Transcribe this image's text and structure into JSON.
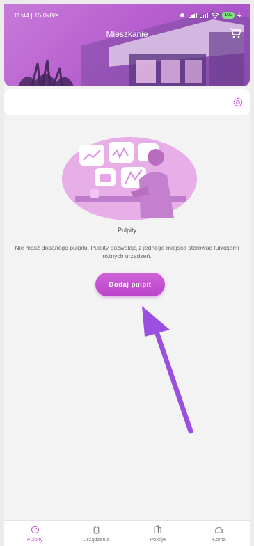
{
  "status_bar": {
    "time_speed": "11:44 | 15,0kB/s",
    "battery": "100"
  },
  "header": {
    "title": "Mieszkanie"
  },
  "empty_state": {
    "title": "Pulpity",
    "description": "Nie masz dodanego pulpitu. Pulpity pozwalają z jednego miejsca sterować funkcjami różnych urządzeń.",
    "button_label": "Dodaj pulpit"
  },
  "nav": {
    "items": [
      {
        "label": "Pulpity",
        "icon": "dashboard-icon",
        "active": true
      },
      {
        "label": "Urządzenia",
        "icon": "device-icon",
        "active": false
      },
      {
        "label": "Pokoje",
        "icon": "rooms-icon",
        "active": false
      },
      {
        "label": "Konta",
        "icon": "home-account-icon",
        "active": false
      }
    ]
  },
  "colors": {
    "accent": "#c25dd0",
    "header_gradient_start": "#c77ad8",
    "header_gradient_end": "#9d4cc0",
    "arrow": "#9b4fe0"
  }
}
